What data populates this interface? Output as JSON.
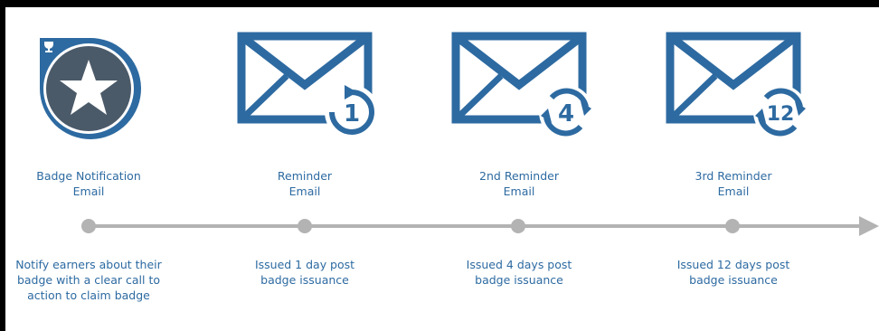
{
  "colors": {
    "primary": "#2d6aa1",
    "badge_fill": "#4b5a69",
    "timeline": "#b3b3b3",
    "frame": "#000000"
  },
  "steps": [
    {
      "icon": "badge-star-icon",
      "title_line1": "Badge Notification",
      "title_line2": "Email",
      "desc_line1": "Notify earners about their",
      "desc_line2": "badge with a clear call to",
      "desc_line3": "action to claim badge"
    },
    {
      "icon": "envelope-refresh-icon",
      "badge_number": "1",
      "title_line1": "Reminder",
      "title_line2": "Email",
      "desc_line1": "Issued 1 day post",
      "desc_line2": "badge issuance"
    },
    {
      "icon": "envelope-refresh-icon",
      "badge_number": "4",
      "title_line1": "2nd Reminder",
      "title_line2": "Email",
      "desc_line1": "Issued 4 days post",
      "desc_line2": "badge issuance"
    },
    {
      "icon": "envelope-refresh-icon",
      "badge_number": "12",
      "title_line1": "3rd Reminder",
      "title_line2": "Email",
      "desc_line1": "Issued 12 days post",
      "desc_line2": "badge issuance"
    }
  ]
}
